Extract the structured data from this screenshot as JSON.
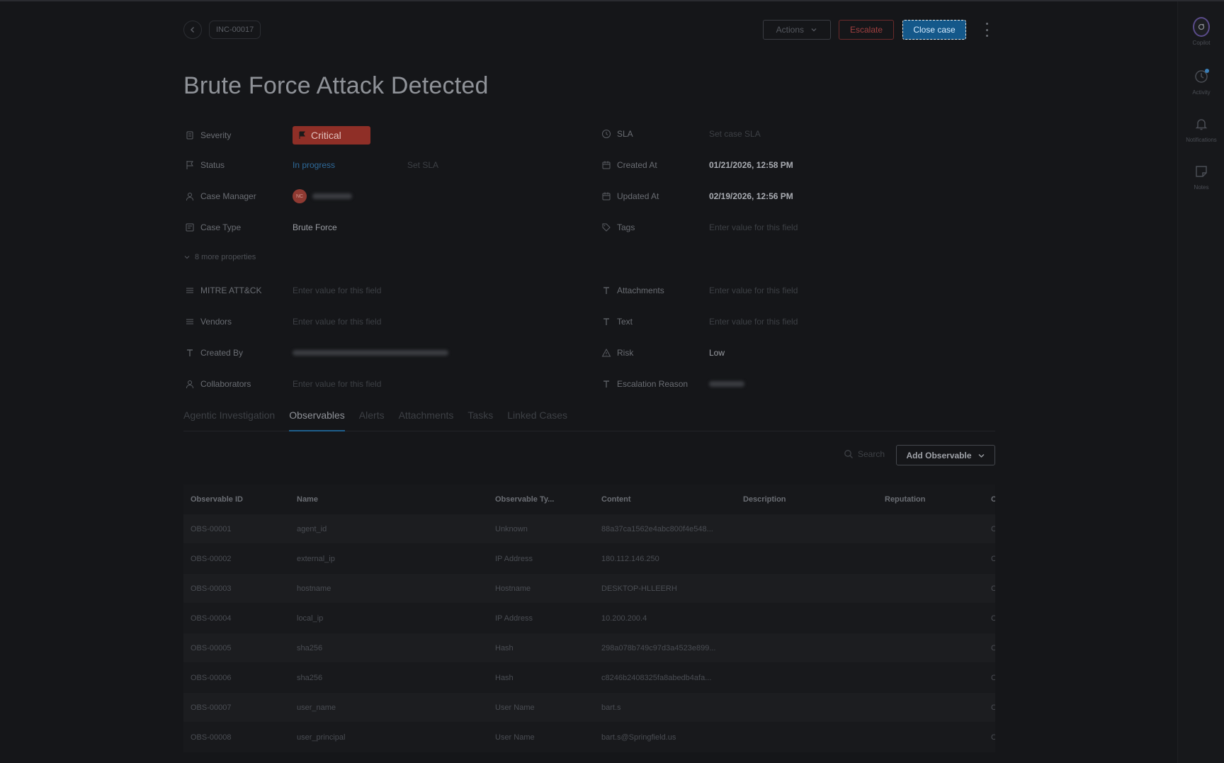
{
  "header": {
    "case_id": "INC-00017",
    "actions_label": "Actions",
    "escalate_label": "Escalate",
    "close_case_label": "Close case"
  },
  "title": "Brute Force Attack Detected",
  "properties_left": {
    "severity_label": "Severity",
    "severity_value": "Critical",
    "status_label": "Status",
    "status_value": "In progress",
    "status_sla": "Set SLA",
    "manager_label": "Case Manager",
    "manager_initials": "NC",
    "case_type_label": "Case Type",
    "case_type_value": "Brute Force",
    "more_label": "8 more properties",
    "mitre_label": "MITRE ATT&CK",
    "mitre_value": "Enter value for this field",
    "vendors_label": "Vendors",
    "vendors_value": "Enter value for this field",
    "created_by_label": "Created By",
    "collaborators_label": "Collaborators",
    "collaborators_value": "Enter value for this field"
  },
  "properties_right": {
    "sla_label": "SLA",
    "sla_value": "Set case SLA",
    "created_at_label": "Created At",
    "created_at_value": "01/21/2026, 12:58 PM",
    "updated_at_label": "Updated At",
    "updated_at_value": "02/19/2026, 12:56 PM",
    "tags_label": "Tags",
    "tags_value": "Enter value for this field",
    "attachments_label": "Attachments",
    "attachments_value": "Enter value for this field",
    "text_label": "Text",
    "text_value": "Enter value for this field",
    "risk_label": "Risk",
    "risk_value": "Low",
    "escalation_label": "Escalation Reason"
  },
  "tabs": [
    "Agentic Investigation",
    "Observables",
    "Alerts",
    "Attachments",
    "Tasks",
    "Linked Cases"
  ],
  "active_tab": "Observables",
  "toolbar": {
    "search_placeholder": "Search",
    "add_label": "Add Observable"
  },
  "table": {
    "columns": [
      "Observable ID",
      "Name",
      "Observable Ty...",
      "Content",
      "Description",
      "Reputation",
      "C"
    ],
    "rows": [
      [
        "OBS-00001",
        "agent_id",
        "Unknown",
        "88a37ca1562e4abc800f4e548...",
        "",
        "",
        "C"
      ],
      [
        "OBS-00002",
        "external_ip",
        "IP Address",
        "180.112.146.250",
        "",
        "",
        "C"
      ],
      [
        "OBS-00003",
        "hostname",
        "Hostname",
        "DESKTOP-HLLEERH",
        "",
        "",
        "C"
      ],
      [
        "OBS-00004",
        "local_ip",
        "IP Address",
        "10.200.200.4",
        "",
        "",
        "C"
      ],
      [
        "OBS-00005",
        "sha256",
        "Hash",
        "298a078b749c97d3a4523e899...",
        "",
        "",
        "C"
      ],
      [
        "OBS-00006",
        "sha256",
        "Hash",
        "c8246b2408325fa8abedb4afa...",
        "",
        "",
        "C"
      ],
      [
        "OBS-00007",
        "user_name",
        "User Name",
        "bart.s",
        "",
        "",
        "C"
      ],
      [
        "OBS-00008",
        "user_principal",
        "User Name",
        "bart.s@Springfield.us",
        "",
        "",
        "C"
      ]
    ]
  },
  "rail": {
    "copilot": "Copilot",
    "activity": "Activity",
    "notifications": "Notifications",
    "notes": "Notes"
  }
}
